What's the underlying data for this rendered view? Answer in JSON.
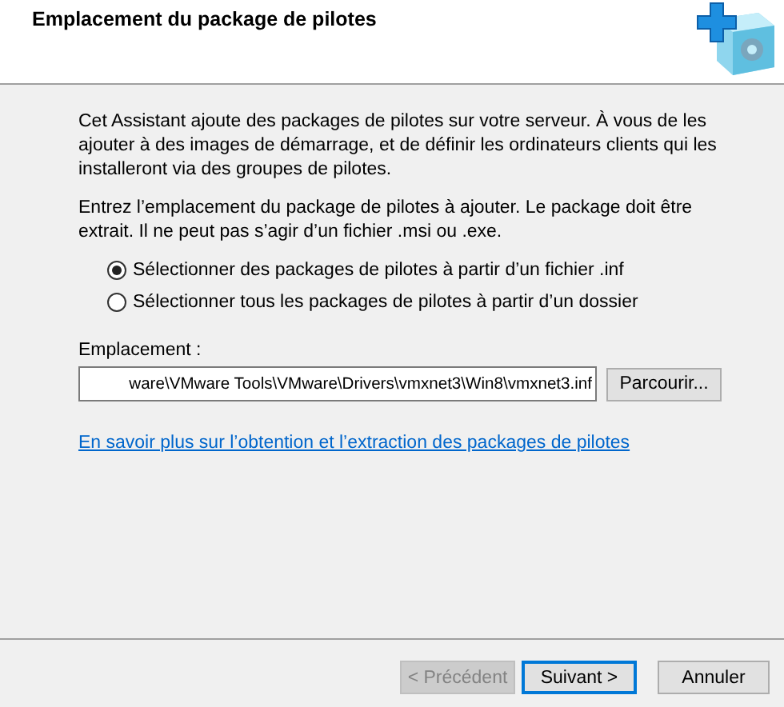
{
  "header": {
    "title": "Emplacement du package de pilotes"
  },
  "intro": "Cet Assistant ajoute des packages de pilotes sur votre serveur. À vous de les ajouter à des images de démarrage, et de définir les ordinateurs clients qui les installeront via des groupes de pilotes.",
  "instruction": "Entrez l’emplacement du package de pilotes à ajouter. Le package doit être extrait. Il ne peut pas s’agir d’un fichier .msi ou .exe.",
  "options": [
    {
      "label": "Sélectionner des packages de pilotes à partir d’un fichier .inf",
      "selected": true
    },
    {
      "label": "Sélectionner tous les packages de pilotes à partir d’un dossier",
      "selected": false
    }
  ],
  "location": {
    "label": "Emplacement :",
    "value": "ware\\VMware Tools\\VMware\\Drivers\\vmxnet3\\Win8\\vmxnet3.inf",
    "browse": "Parcourir..."
  },
  "link": "En savoir plus sur l’obtention et l’extraction des packages de pilotes",
  "buttons": [
    {
      "label": "< Précédent",
      "disabled": true,
      "default": false
    },
    {
      "label": "Suivant >",
      "disabled": false,
      "default": true
    },
    {
      "label": "Annuler",
      "disabled": false,
      "default": false
    }
  ]
}
